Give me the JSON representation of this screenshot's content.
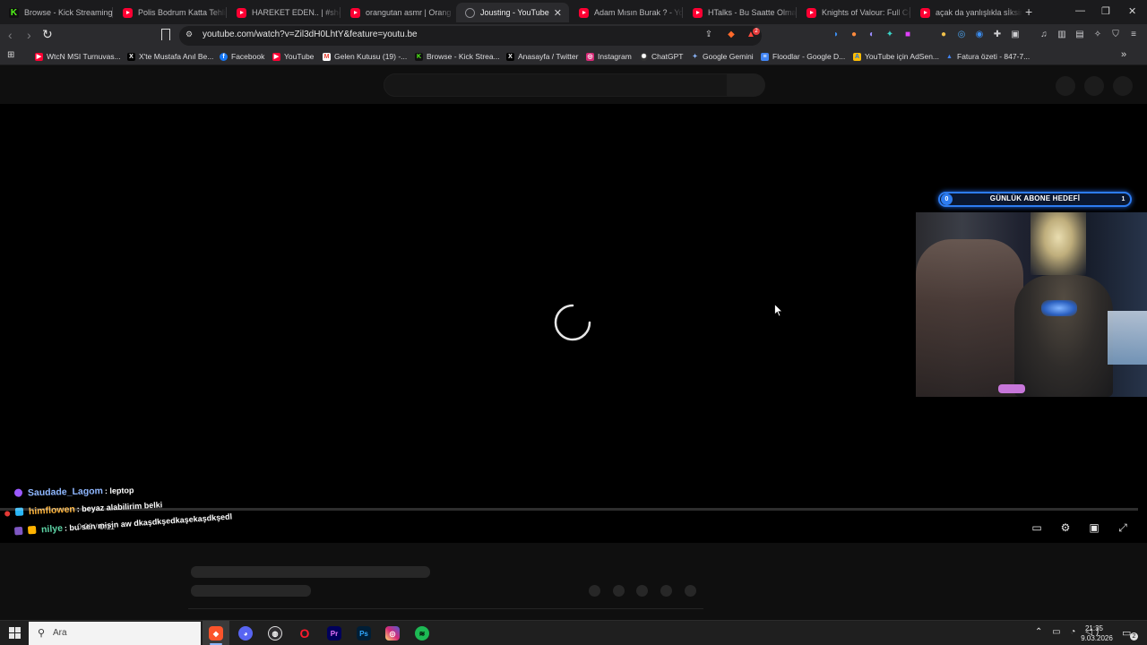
{
  "tabs": [
    {
      "label": "Browse - Kick Streaming",
      "icon": "kick-icon"
    },
    {
      "label": "Polis Bodrum Katta Tehlike",
      "icon": "youtube-icon"
    },
    {
      "label": "HAREKET EDEN.. | #shorts",
      "icon": "youtube-icon"
    },
    {
      "label": "orangutan asmr | Orang U",
      "icon": "youtube-icon"
    },
    {
      "label": "Jousting - YouTube",
      "icon": "loading-globe-icon",
      "active": true
    },
    {
      "label": "Adam Mısın Burak ? - You",
      "icon": "youtube-icon"
    },
    {
      "label": "HTalks - Bu Saatte Olmaz (",
      "icon": "youtube-icon"
    },
    {
      "label": "Knights of Valour: Full Com",
      "icon": "youtube-icon"
    },
    {
      "label": "açak da yanlışlıkla sİksinle",
      "icon": "youtube-icon"
    }
  ],
  "tab_close": "✕",
  "new_tab": "+",
  "window_controls": {
    "minimize": "—",
    "restore": "❐",
    "close": "✕"
  },
  "address_bar": {
    "url": "youtube.com/watch?v=Zil3dH0LhtY&feature=youtu.be"
  },
  "extension_badge": "2",
  "bookmarks": [
    {
      "label": "WtcN MSI Turnuvas...",
      "icon": "youtube-icon"
    },
    {
      "label": "X'te Mustafa Anıl Be...",
      "icon": "x-icon"
    },
    {
      "label": "Facebook",
      "icon": "facebook-icon"
    },
    {
      "label": "YouTube",
      "icon": "youtube-icon"
    },
    {
      "label": "Gelen Kutusu (19) -...",
      "icon": "gmail-icon"
    },
    {
      "label": "Browse - Kick Strea...",
      "icon": "kick-icon"
    },
    {
      "label": "Anasayfa / Twitter",
      "icon": "x-icon"
    },
    {
      "label": "Instagram",
      "icon": "instagram-icon"
    },
    {
      "label": "ChatGPT",
      "icon": "chatgpt-icon"
    },
    {
      "label": "Google Gemini",
      "icon": "gemini-icon"
    },
    {
      "label": "Floodlar - Google D...",
      "icon": "google-docs-icon"
    },
    {
      "label": "YouTube için AdSen...",
      "icon": "adsense-icon"
    },
    {
      "label": "Fatura özeti - 847-7...",
      "icon": "google-ads-icon"
    }
  ],
  "bookmarks_overflow": "»",
  "overlay": {
    "sub_goal_title": "GÜNLÜK ABONE HEDEFİ",
    "sub_goal_current": "0",
    "sub_goal_target": "1",
    "sub_goal_progress": 0
  },
  "chat": [
    {
      "user": "Saudade_Lagom",
      "message": ": leptop",
      "color": "#8fb7ff"
    },
    {
      "user": "himflowen",
      "message": ": beyaz alabilirim belki",
      "color": "#ffb43a"
    },
    {
      "user": "nilye",
      "message": ": bu sen misin aw dkaşdkşedkaşekaşdkşedl",
      "color": "#5ed6a7"
    }
  ],
  "player": {
    "time_display": "0:00 / 0:11",
    "progress": 0,
    "state": "loading"
  },
  "taskbar": {
    "search_placeholder": "Ara",
    "apps": [
      "brave-icon",
      "discord-icon",
      "obs-icon",
      "opera-icon",
      "premiere-icon",
      "photoshop-icon",
      "instagram-icon",
      "spotify-icon"
    ],
    "clock_time": "21:35",
    "clock_date": "9.03.2026",
    "notification_count": "2"
  },
  "colors": {
    "page_bg": "#0f0f0f",
    "player_bg": "#000000",
    "browser_chrome": "#2b2b2e",
    "accent_blue": "#2d7cf0",
    "youtube_red": "#ff0033"
  }
}
